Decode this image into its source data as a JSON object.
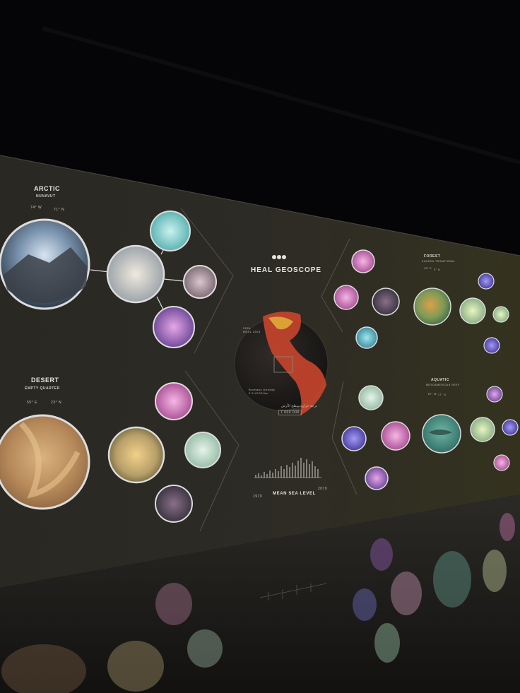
{
  "exhibit": {
    "title": "HEAL GEOSCOPE",
    "mean_sea_level_label": "MEAN SEA LEVEL",
    "year_start": "1970",
    "year_end": "2070",
    "counter_value": "7 000 000 ",
    "arabic_caption": "درجة حرارة سطح الأرض",
    "annotation_1": "2024\nHEAL 2024",
    "annotation_2": "Biomass Density\n2.5 tCO2/ha"
  },
  "biomes": {
    "arctic": {
      "name": "ARCTIC",
      "region": "NUNAVUT",
      "lon": "74° W",
      "lat": "71° N"
    },
    "desert": {
      "name": "DESERT",
      "region": "EMPTY QUARTER",
      "lon": "55° E",
      "lat": "23° N"
    },
    "forest": {
      "name": "FOREST",
      "region": "SANGHA TRINATIONAL",
      "lon": "16° E",
      "lat": "3° N"
    },
    "aquatic": {
      "name": "AQUATIC",
      "region": "MESOAMERICAN REEF",
      "lon": "87° W",
      "lat": "17° N"
    }
  },
  "colors": {
    "wall": "#2b2924",
    "floor": "#1a1917",
    "ceiling": "#050507",
    "ring": "#dcdcdc"
  }
}
